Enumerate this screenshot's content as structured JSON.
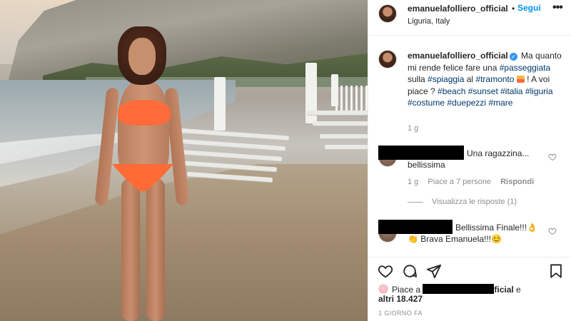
{
  "post": {
    "username": "emanuelafolliero_official",
    "follow_label": "Segui",
    "dot": "•",
    "location": "Liguria, Italy",
    "more_label": "•••",
    "photo_alt": "woman in orange bikini on beach at sunset"
  },
  "caption": {
    "username": "emanuelafolliero_official",
    "verified_icon": "✓",
    "line1": " Ma quanto mi rende felice fare una ",
    "tag_passeggiata": "#passeggiata",
    "w_sulla": " sulla ",
    "tag_spiaggia": "#spiaggia",
    "w_al": " al ",
    "tag_tramonto": "#tramonto",
    "w_voi": " ! A voi piace ? ",
    "tag_beach": "#beach",
    "tag_sunset": "#sunset",
    "tag_italia": "#italia",
    "tag_liguria": "#liguria",
    "tag_costume": "#costume",
    "tag_duepezzi": "#duepezzi",
    "tag_mare": "#mare",
    "time": "1 g"
  },
  "comments": [
    {
      "text1": "Una ragazzina...",
      "text2": "bellissima",
      "time": "1 g",
      "likes": "Piace a 7 persone",
      "reply": "Rispondi",
      "view_replies": "Visualizza le risposte (1)"
    },
    {
      "text1": "Bellissima Finale!!!👌",
      "text2": "👏 Brava Emanuela!!!😊"
    }
  ],
  "likes": {
    "prefix": "Piace a ",
    "suffix": "ficial",
    "connector": " e",
    "others": "altri 18.427",
    "time_ago": "1 GIORNO FA"
  },
  "icons": {
    "like": "heart-icon",
    "comment": "comment-icon",
    "share": "share-icon",
    "save": "bookmark-icon"
  },
  "colors": {
    "follow_blue": "#0095f6",
    "hashtag": "#00376b",
    "meta_gray": "#8e8e8e",
    "verified": "#3897f0",
    "bikini": "#ff6b3a"
  }
}
